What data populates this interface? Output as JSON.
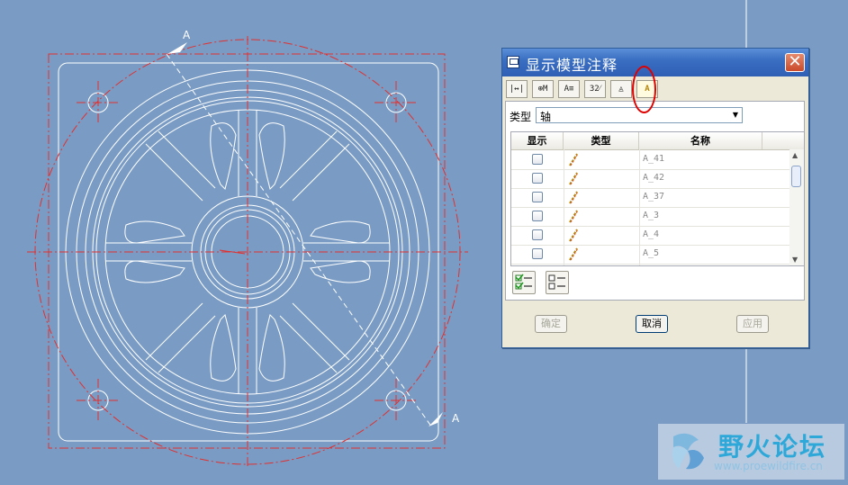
{
  "drawing": {
    "section_label_top": "A",
    "section_label_bottom": "A"
  },
  "dialog": {
    "title": "显示模型注释",
    "close_glyph": "✕",
    "toolbar": [
      {
        "name": "dimension-tab",
        "glyph": "|↔|"
      },
      {
        "name": "gtol-tab",
        "glyph": "⊕M"
      },
      {
        "name": "note-tab",
        "glyph": "A≡"
      },
      {
        "name": "surface-finish-tab",
        "glyph": "32⁄"
      },
      {
        "name": "datum-target-tab",
        "glyph": "◬"
      },
      {
        "name": "datum-axis-tab",
        "glyph": "A"
      }
    ],
    "type_label": "类型",
    "type_value": "轴",
    "columns": {
      "show": "显示",
      "type": "类型",
      "name": "名称"
    },
    "rows": [
      {
        "name": "A_41",
        "checked": false
      },
      {
        "name": "A_42",
        "checked": false
      },
      {
        "name": "A_37",
        "checked": false
      },
      {
        "name": "A_3",
        "checked": false
      },
      {
        "name": "A_4",
        "checked": false
      },
      {
        "name": "A_5",
        "checked": false
      }
    ],
    "buttons": {
      "ok": "确定",
      "cancel": "取消",
      "apply": "应用"
    }
  },
  "watermark": {
    "title": "野火论坛",
    "url": "www.proewildfire.cn"
  },
  "colors": {
    "background": "#7a9cc4",
    "drawing_line": "#ffffff",
    "centerline": "#e03030",
    "highlight": "#e00000"
  }
}
